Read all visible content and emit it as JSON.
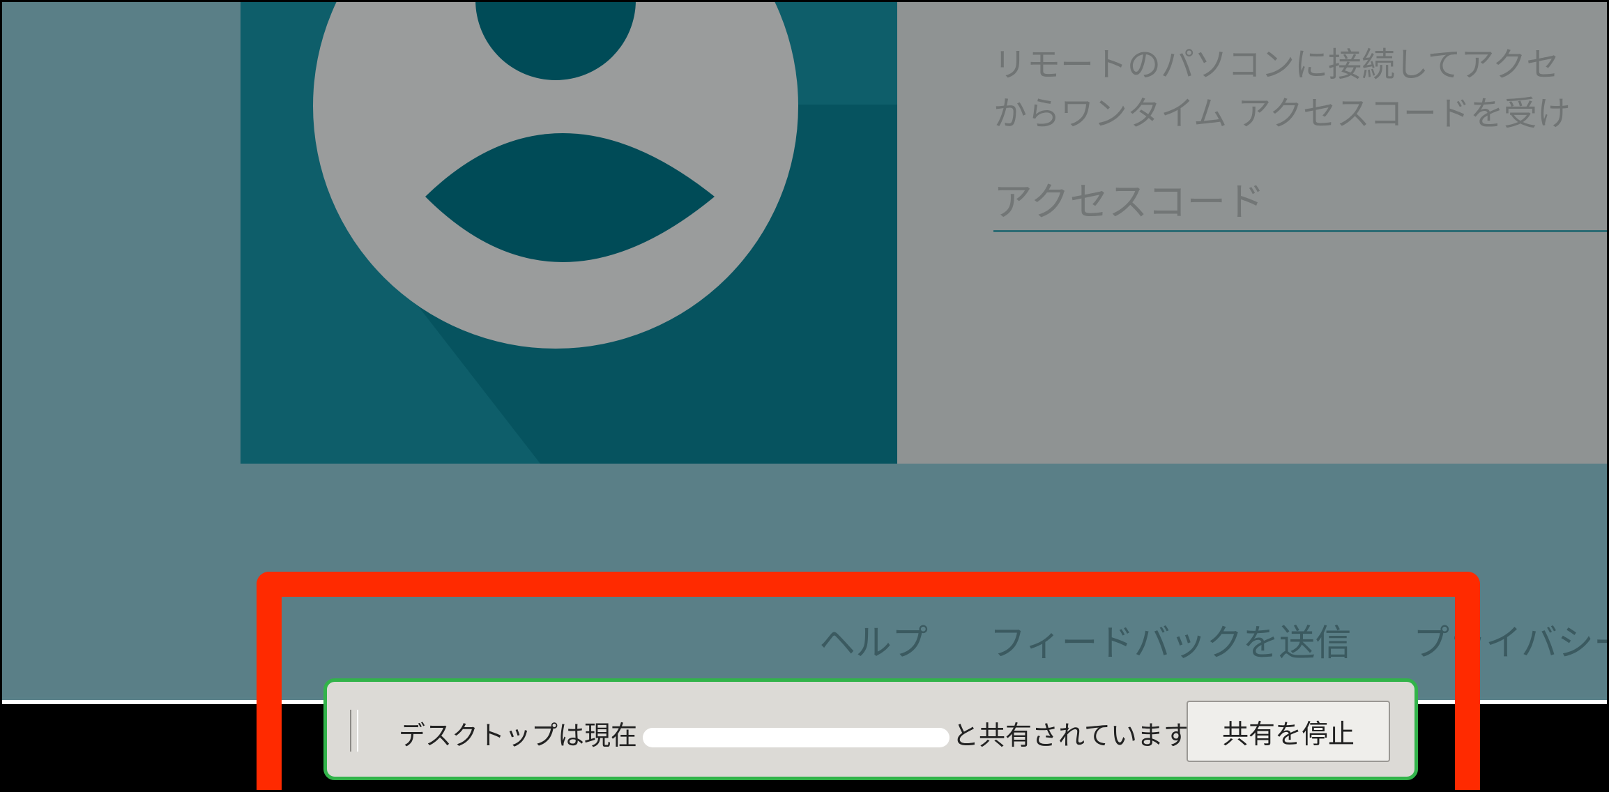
{
  "panel": {
    "line1": "リモートのパソコンに接続してアクセ",
    "line2": "からワンタイム アクセスコードを受け",
    "access_code_placeholder": "アクセスコード"
  },
  "footer": {
    "help": "ヘルプ",
    "feedback": "フィードバックを送信",
    "privacy": "プライバシー"
  },
  "share_bar": {
    "text_before": "デスクトップは現在",
    "text_after": "と共有されています。",
    "stop_button": "共有を停止"
  },
  "colors": {
    "highlight": "#ff2a00",
    "share_bar_border": "#32b34a",
    "avatar_tile": "#0e5e6a",
    "panel": "#8f9393"
  },
  "icons": {
    "avatar": "user-avatar-icon"
  }
}
